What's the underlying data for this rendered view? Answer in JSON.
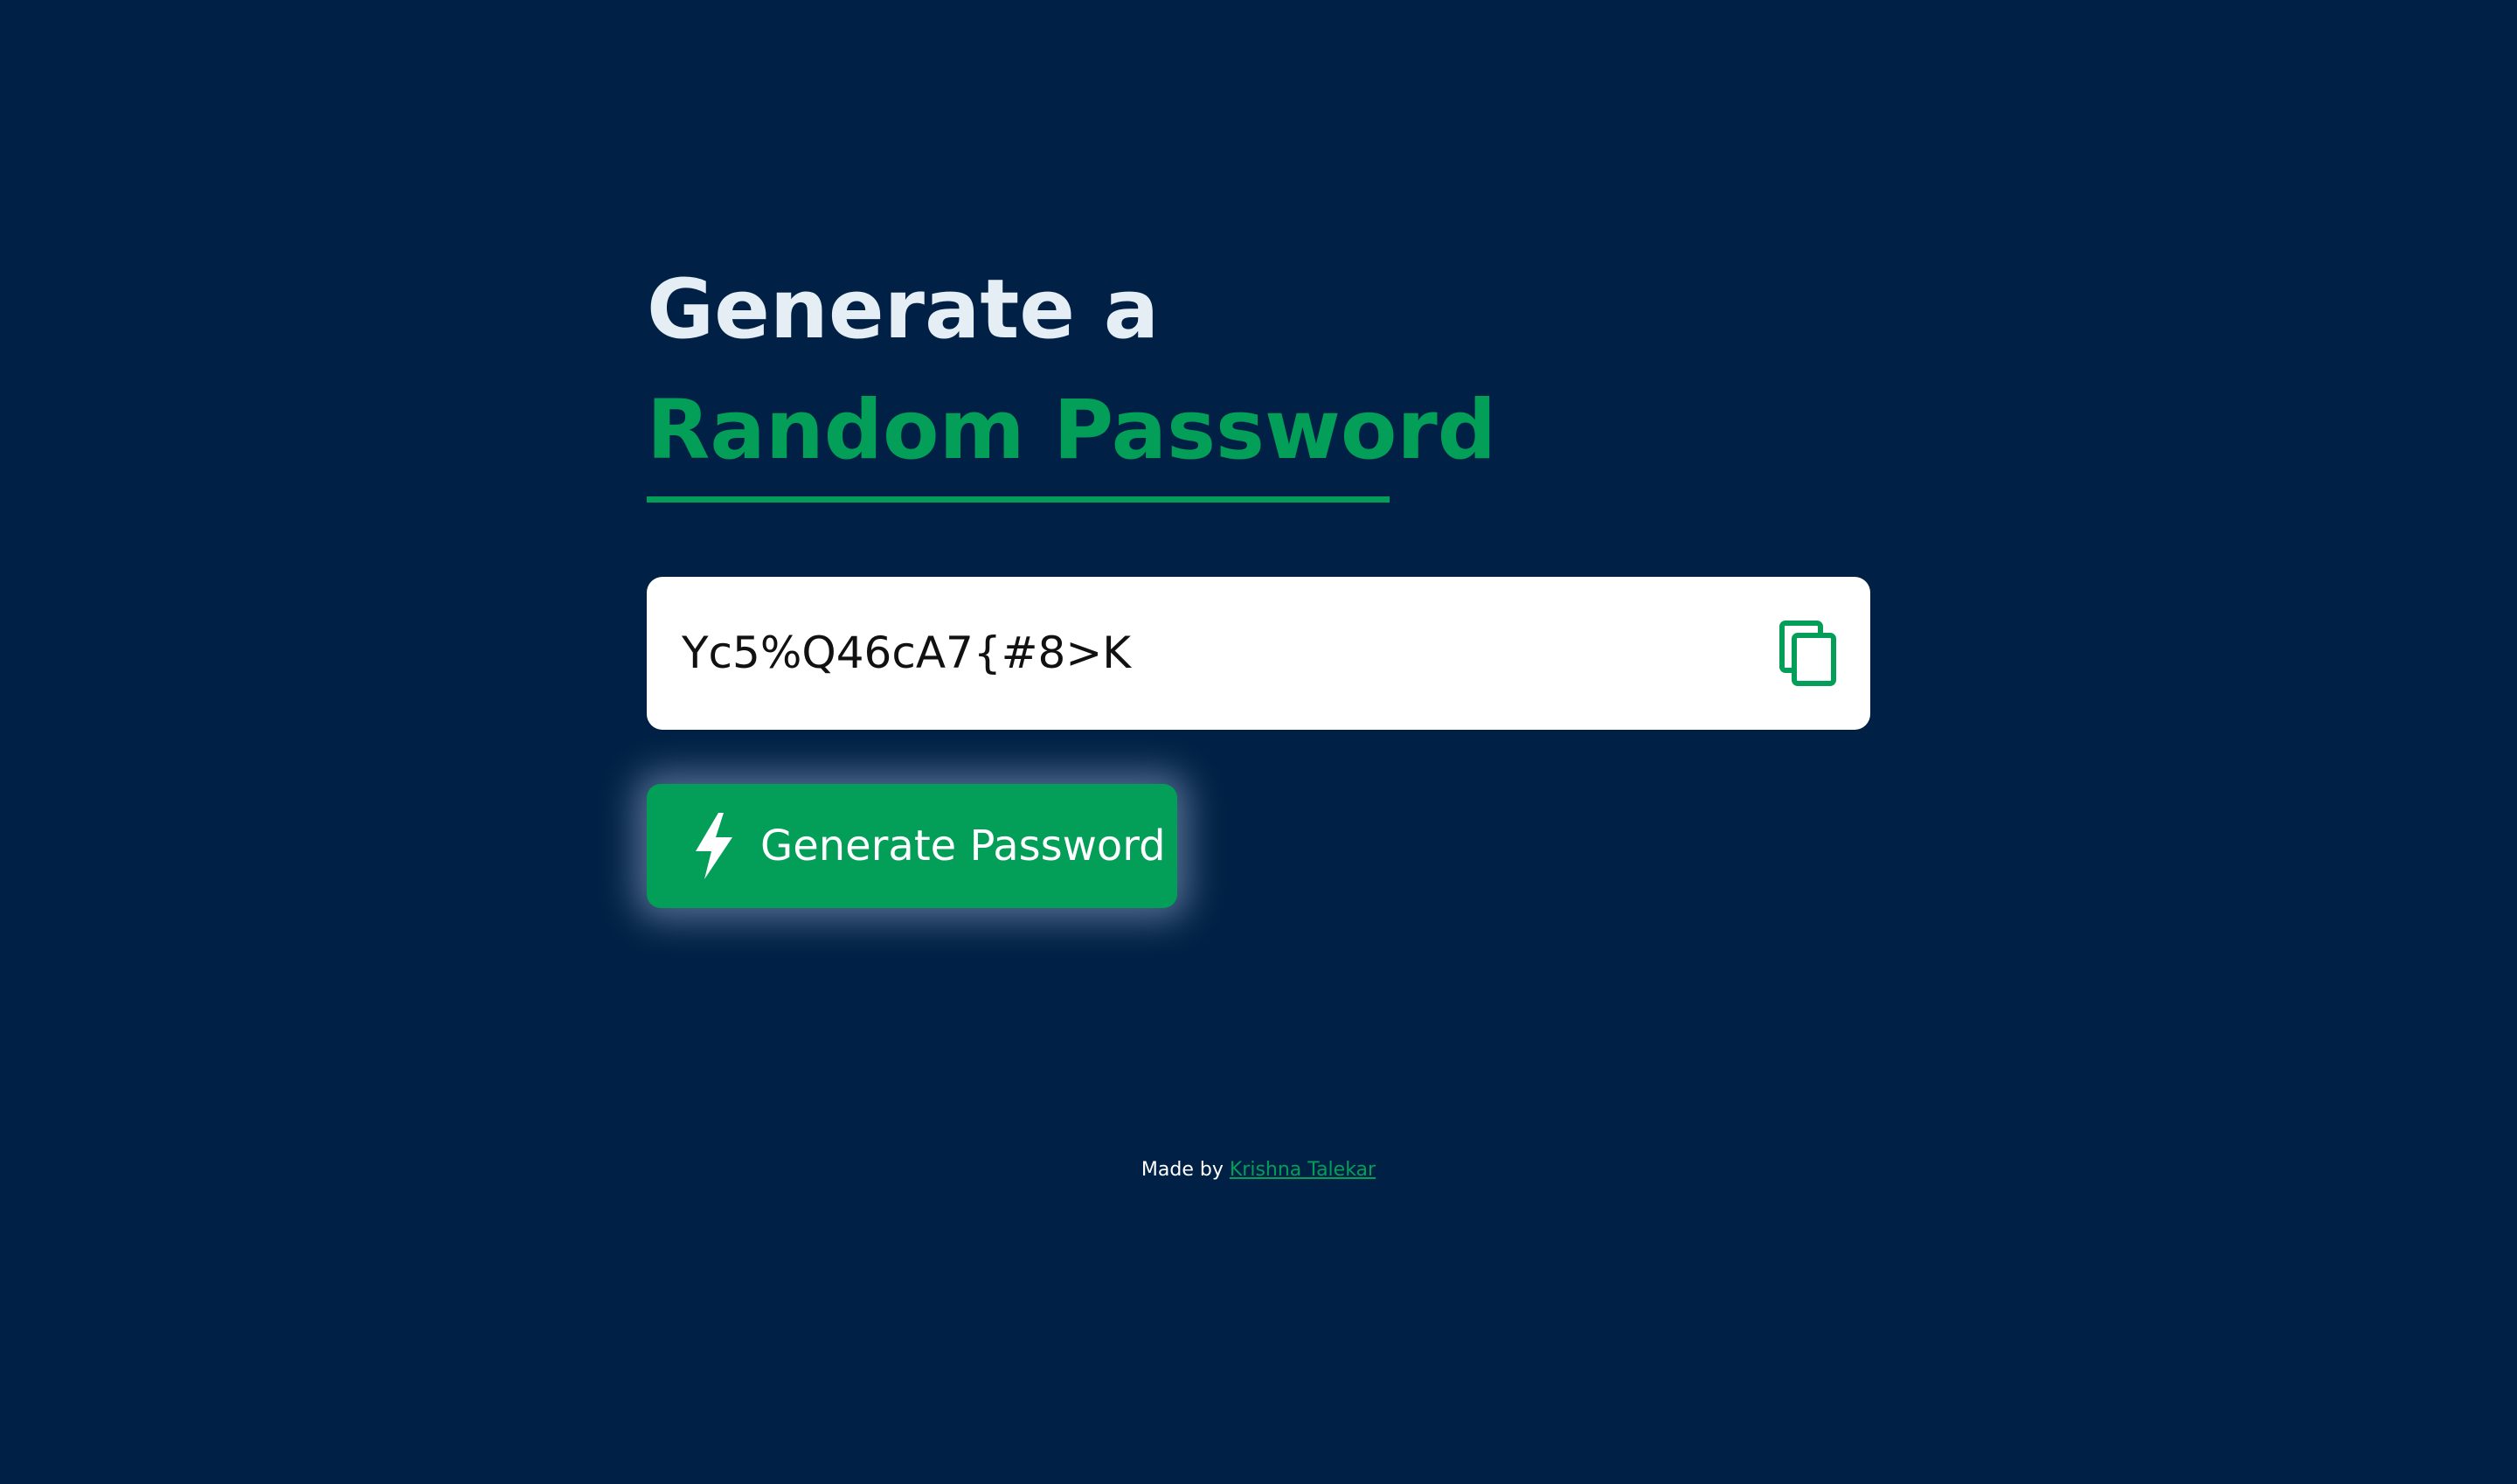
{
  "heading": {
    "line1": "Generate a",
    "line2": "Random Password"
  },
  "password": {
    "value": "Yc5%Q46cA7{#8>K"
  },
  "generate_button": {
    "label": "Generate Password"
  },
  "footer": {
    "prefix": "Made by",
    "author": "Krishna Talekar"
  },
  "colors": {
    "background": "#002145",
    "accent": "#039e58",
    "heading_light": "#e5edf5",
    "box_background": "#ffffff"
  },
  "icons": {
    "copy": "copy-icon",
    "generate": "lightning-bolt-icon"
  }
}
